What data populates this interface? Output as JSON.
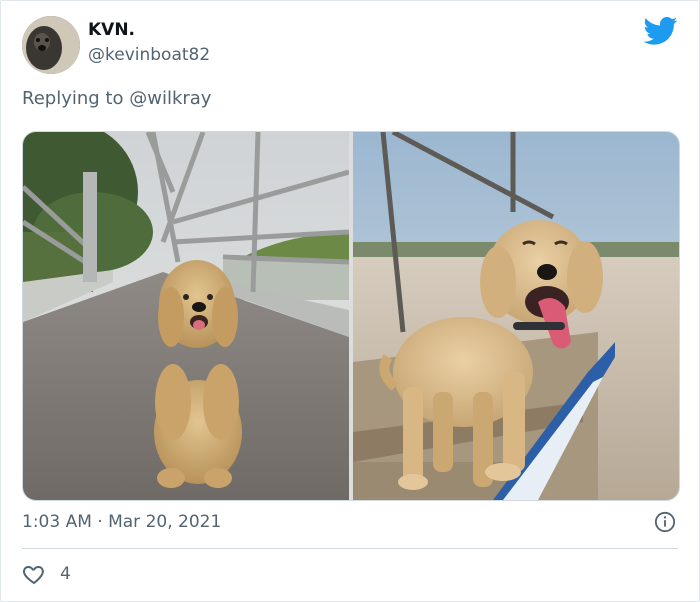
{
  "author": {
    "name": "KVN.",
    "handle": "@kevinboat82"
  },
  "reply": {
    "prefix": "Replying to",
    "mention": "@wilkray"
  },
  "media": {
    "photos": [
      "dog-on-bridge-photo",
      "dog-on-boat-photo"
    ]
  },
  "meta": {
    "timestamp": "1:03 AM · Mar 20, 2021"
  },
  "actions": {
    "like_count": "4"
  },
  "colors": {
    "brand": "#1d9bf0",
    "secondary_text": "#536471",
    "border": "#cfd9de"
  }
}
